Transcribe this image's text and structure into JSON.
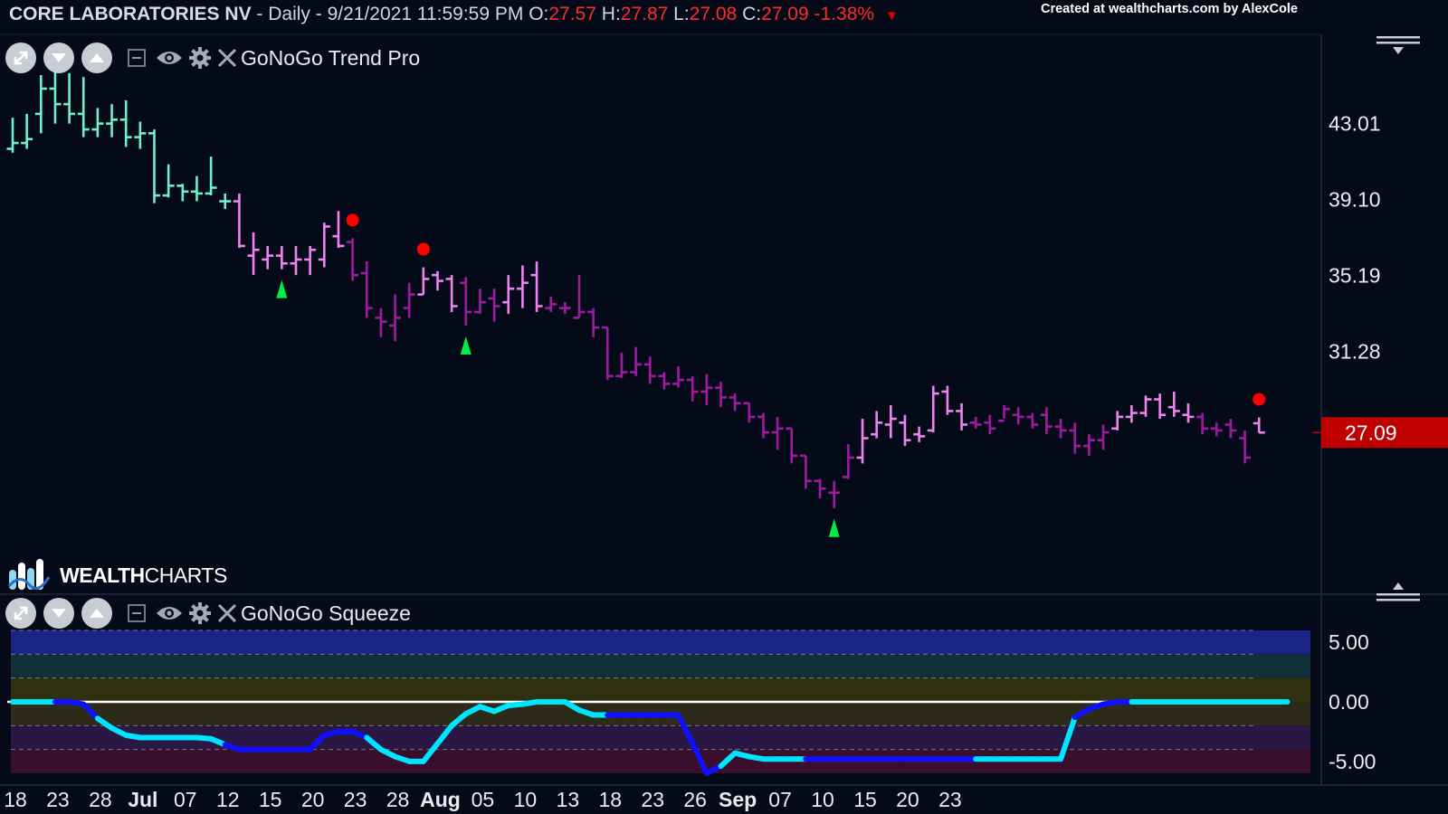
{
  "header": {
    "symbol": "CORE LABORATORIES NV",
    "info": " - Daily - 9/21/2021 11:59:59 PM ",
    "open_label": "O:",
    "open": "27.57",
    "high_label": " H:",
    "high": "27.87",
    "low_label": " L:",
    "low": "27.08",
    "close_label": " C:",
    "close": "27.09",
    "change": " -1.38% ",
    "credit": "Created at wealthcharts.com by AlexCole"
  },
  "icons": [
    "expand-icon",
    "chevron-down-icon",
    "chevron-up-icon",
    "collapse-icon",
    "eye-icon",
    "gear-icon",
    "close-icon",
    "menu-icon"
  ],
  "indicators": {
    "trend": "GoNoGo Trend Pro",
    "squeeze": "GoNoGo Squeeze"
  },
  "logo": {
    "bold": "WEALTH",
    "light": "CHARTS"
  },
  "colors": {
    "background": "#050a18",
    "go_strong": "#6ff0c8",
    "nogo_light": "#ee82ee",
    "nogo_strong": "#a01aa0",
    "reversal_dot": "#ff0000",
    "go_triangle": "#00ee44",
    "price_tag": "#c00000",
    "squeeze_cyan": "#00e5ff",
    "squeeze_blue": "#1010ff",
    "zero_line": "#ffffff"
  },
  "chart_data": [
    {
      "type": "ohlc",
      "name": "GoNoGo Trend Pro",
      "y_ticks": [
        43.01,
        39.1,
        35.19,
        31.28
      ],
      "ylim": [
        19.0,
        47.5
      ],
      "last_price": "27.09",
      "x_ticks": [
        "18",
        "23",
        "28",
        "Jul",
        "07",
        "12",
        "15",
        "20",
        "23",
        "28",
        "Aug",
        "05",
        "10",
        "13",
        "18",
        "23",
        "26",
        "Sep",
        "07",
        "10",
        "15",
        "20",
        "23"
      ],
      "x_tick_indexes": [
        0,
        3,
        6,
        9,
        12,
        15,
        18,
        21,
        24,
        27,
        30,
        33,
        36,
        39,
        42,
        45,
        48,
        51,
        54,
        57,
        60,
        63,
        66
      ],
      "bars": [
        {
          "o": 41.7,
          "h": 43.3,
          "l": 41.5,
          "c": 42.0,
          "s": "go"
        },
        {
          "o": 42.0,
          "h": 43.5,
          "l": 41.7,
          "c": 42.2,
          "s": "go"
        },
        {
          "o": 43.5,
          "h": 45.5,
          "l": 42.5,
          "c": 44.8,
          "s": "go"
        },
        {
          "o": 44.8,
          "h": 45.8,
          "l": 43.0,
          "c": 44.0,
          "s": "go"
        },
        {
          "o": 44.0,
          "h": 45.6,
          "l": 43.0,
          "c": 43.5,
          "s": "go"
        },
        {
          "o": 43.5,
          "h": 45.4,
          "l": 42.3,
          "c": 42.7,
          "s": "go"
        },
        {
          "o": 42.7,
          "h": 43.8,
          "l": 42.3,
          "c": 43.0,
          "s": "go"
        },
        {
          "o": 43.0,
          "h": 44.0,
          "l": 42.3,
          "c": 43.2,
          "s": "go"
        },
        {
          "o": 43.2,
          "h": 44.2,
          "l": 41.8,
          "c": 42.3,
          "s": "go"
        },
        {
          "o": 42.3,
          "h": 43.1,
          "l": 41.7,
          "c": 42.5,
          "s": "go"
        },
        {
          "o": 42.5,
          "h": 42.7,
          "l": 38.9,
          "c": 39.3,
          "s": "go"
        },
        {
          "o": 39.3,
          "h": 40.9,
          "l": 39.2,
          "c": 39.8,
          "s": "go"
        },
        {
          "o": 39.8,
          "h": 39.9,
          "l": 39.0,
          "c": 39.5,
          "s": "go"
        },
        {
          "o": 39.5,
          "h": 40.3,
          "l": 39.0,
          "c": 39.4,
          "s": "go"
        },
        {
          "o": 39.4,
          "h": 41.3,
          "l": 39.3,
          "c": 39.7,
          "s": "go"
        },
        {
          "o": 39.0,
          "h": 39.4,
          "l": 38.6,
          "c": 39.0,
          "s": "go"
        },
        {
          "o": 39.0,
          "h": 39.4,
          "l": 36.6,
          "c": 36.7,
          "s": "nogo"
        },
        {
          "o": 36.2,
          "h": 37.4,
          "l": 35.2,
          "c": 36.5,
          "s": "nogo"
        },
        {
          "o": 36.0,
          "h": 36.7,
          "l": 35.5,
          "c": 36.2,
          "s": "nogo"
        },
        {
          "o": 36.2,
          "h": 36.7,
          "l": 35.5,
          "c": 35.8,
          "s": "nogo"
        },
        {
          "o": 35.8,
          "h": 36.7,
          "l": 35.2,
          "c": 36.0,
          "s": "nogo"
        },
        {
          "o": 36.0,
          "h": 36.7,
          "l": 35.2,
          "c": 36.5,
          "s": "nogo"
        },
        {
          "o": 36.0,
          "h": 37.9,
          "l": 35.6,
          "c": 37.7,
          "s": "nogo"
        },
        {
          "o": 37.2,
          "h": 38.5,
          "l": 36.6,
          "c": 36.7,
          "s": "nogo"
        },
        {
          "o": 36.9,
          "h": 37.1,
          "l": 34.9,
          "c": 35.2,
          "s": "nogo_strong"
        },
        {
          "o": 35.3,
          "h": 35.9,
          "l": 33.0,
          "c": 33.5,
          "s": "nogo_strong"
        },
        {
          "o": 33.0,
          "h": 33.5,
          "l": 32.0,
          "c": 32.8,
          "s": "nogo_strong"
        },
        {
          "o": 32.6,
          "h": 34.2,
          "l": 31.8,
          "c": 33.0,
          "s": "nogo_strong"
        },
        {
          "o": 33.5,
          "h": 34.8,
          "l": 33.0,
          "c": 34.2,
          "s": "nogo_strong"
        },
        {
          "o": 34.2,
          "h": 35.6,
          "l": 34.2,
          "c": 35.0,
          "s": "nogo"
        },
        {
          "o": 35.2,
          "h": 35.4,
          "l": 34.4,
          "c": 34.9,
          "s": "nogo"
        },
        {
          "o": 35.0,
          "h": 35.2,
          "l": 33.3,
          "c": 33.6,
          "s": "nogo"
        },
        {
          "o": 34.8,
          "h": 35.1,
          "l": 32.6,
          "c": 33.3,
          "s": "nogo_strong"
        },
        {
          "o": 33.3,
          "h": 34.5,
          "l": 33.2,
          "c": 33.8,
          "s": "nogo_strong"
        },
        {
          "o": 34.0,
          "h": 34.5,
          "l": 32.8,
          "c": 33.6,
          "s": "nogo_strong"
        },
        {
          "o": 33.8,
          "h": 35.2,
          "l": 33.2,
          "c": 34.5,
          "s": "nogo"
        },
        {
          "o": 34.5,
          "h": 35.7,
          "l": 33.5,
          "c": 34.8,
          "s": "nogo"
        },
        {
          "o": 35.2,
          "h": 35.9,
          "l": 33.3,
          "c": 33.6,
          "s": "nogo"
        },
        {
          "o": 33.5,
          "h": 34.1,
          "l": 33.3,
          "c": 33.7,
          "s": "nogo_strong"
        },
        {
          "o": 33.5,
          "h": 33.8,
          "l": 33.2,
          "c": 33.5,
          "s": "nogo_strong"
        },
        {
          "o": 33.0,
          "h": 35.2,
          "l": 33.0,
          "c": 33.3,
          "s": "nogo_strong"
        },
        {
          "o": 33.3,
          "h": 33.5,
          "l": 32.0,
          "c": 32.5,
          "s": "nogo_strong"
        },
        {
          "o": 32.5,
          "h": 32.5,
          "l": 29.8,
          "c": 30.0,
          "s": "nogo_strong"
        },
        {
          "o": 30.0,
          "h": 31.2,
          "l": 29.9,
          "c": 30.2,
          "s": "nogo_strong"
        },
        {
          "o": 30.2,
          "h": 31.5,
          "l": 30.0,
          "c": 30.6,
          "s": "nogo_strong"
        },
        {
          "o": 30.6,
          "h": 31.0,
          "l": 29.6,
          "c": 30.0,
          "s": "nogo_strong"
        },
        {
          "o": 30.0,
          "h": 30.2,
          "l": 29.3,
          "c": 29.6,
          "s": "nogo_strong"
        },
        {
          "o": 29.6,
          "h": 30.5,
          "l": 29.4,
          "c": 29.8,
          "s": "nogo_strong"
        },
        {
          "o": 29.8,
          "h": 30.0,
          "l": 28.7,
          "c": 29.2,
          "s": "nogo_strong"
        },
        {
          "o": 29.2,
          "h": 30.1,
          "l": 28.5,
          "c": 29.4,
          "s": "nogo_strong"
        },
        {
          "o": 29.4,
          "h": 29.7,
          "l": 28.4,
          "c": 28.9,
          "s": "nogo_strong"
        },
        {
          "o": 28.9,
          "h": 29.1,
          "l": 28.2,
          "c": 28.6,
          "s": "nogo_strong"
        },
        {
          "o": 28.6,
          "h": 28.6,
          "l": 27.6,
          "c": 27.9,
          "s": "nogo_strong"
        },
        {
          "o": 27.9,
          "h": 28.1,
          "l": 26.8,
          "c": 27.1,
          "s": "nogo_strong"
        },
        {
          "o": 27.1,
          "h": 27.9,
          "l": 26.2,
          "c": 27.3,
          "s": "nogo_strong"
        },
        {
          "o": 27.3,
          "h": 27.3,
          "l": 25.5,
          "c": 25.9,
          "s": "nogo_strong"
        },
        {
          "o": 25.9,
          "h": 25.9,
          "l": 24.2,
          "c": 24.6,
          "s": "nogo_strong"
        },
        {
          "o": 24.6,
          "h": 24.7,
          "l": 23.7,
          "c": 24.2,
          "s": "nogo_strong"
        },
        {
          "o": 24.0,
          "h": 24.6,
          "l": 23.2,
          "c": 24.0,
          "s": "nogo_strong"
        },
        {
          "o": 24.8,
          "h": 26.5,
          "l": 24.7,
          "c": 25.8,
          "s": "nogo_strong"
        },
        {
          "o": 25.8,
          "h": 27.8,
          "l": 25.5,
          "c": 26.8,
          "s": "nogo"
        },
        {
          "o": 27.0,
          "h": 28.2,
          "l": 26.8,
          "c": 27.6,
          "s": "nogo"
        },
        {
          "o": 27.5,
          "h": 28.5,
          "l": 26.8,
          "c": 27.8,
          "s": "nogo"
        },
        {
          "o": 27.6,
          "h": 28.0,
          "l": 26.4,
          "c": 26.7,
          "s": "nogo"
        },
        {
          "o": 27.0,
          "h": 27.4,
          "l": 26.6,
          "c": 26.9,
          "s": "nogo"
        },
        {
          "o": 27.2,
          "h": 29.5,
          "l": 27.1,
          "c": 29.1,
          "s": "nogo"
        },
        {
          "o": 29.2,
          "h": 29.5,
          "l": 28.0,
          "c": 28.2,
          "s": "nogo"
        },
        {
          "o": 28.2,
          "h": 28.6,
          "l": 27.2,
          "c": 27.5,
          "s": "nogo"
        },
        {
          "o": 27.6,
          "h": 27.9,
          "l": 27.3,
          "c": 27.5,
          "s": "nogo_strong"
        },
        {
          "o": 27.6,
          "h": 28.0,
          "l": 27.0,
          "c": 27.3,
          "s": "nogo_strong"
        },
        {
          "o": 27.7,
          "h": 28.5,
          "l": 27.8,
          "c": 28.3,
          "s": "nogo_strong"
        },
        {
          "o": 28.0,
          "h": 28.4,
          "l": 27.5,
          "c": 27.9,
          "s": "nogo_strong"
        },
        {
          "o": 27.9,
          "h": 28.1,
          "l": 27.3,
          "c": 27.5,
          "s": "nogo_strong"
        },
        {
          "o": 28.0,
          "h": 28.4,
          "l": 27.0,
          "c": 27.4,
          "s": "nogo_strong"
        },
        {
          "o": 27.4,
          "h": 27.8,
          "l": 26.8,
          "c": 27.2,
          "s": "nogo_strong"
        },
        {
          "o": 27.2,
          "h": 27.6,
          "l": 26.0,
          "c": 26.4,
          "s": "nogo_strong"
        },
        {
          "o": 26.4,
          "h": 27.0,
          "l": 25.9,
          "c": 26.7,
          "s": "nogo_strong"
        },
        {
          "o": 26.7,
          "h": 27.5,
          "l": 26.2,
          "c": 27.1,
          "s": "nogo_strong"
        },
        {
          "o": 27.3,
          "h": 28.2,
          "l": 27.2,
          "c": 27.9,
          "s": "nogo"
        },
        {
          "o": 27.9,
          "h": 28.5,
          "l": 27.6,
          "c": 28.1,
          "s": "nogo"
        },
        {
          "o": 28.1,
          "h": 29.0,
          "l": 27.9,
          "c": 28.8,
          "s": "nogo"
        },
        {
          "o": 28.8,
          "h": 29.1,
          "l": 27.8,
          "c": 28.0,
          "s": "nogo"
        },
        {
          "o": 28.4,
          "h": 29.2,
          "l": 27.9,
          "c": 28.2,
          "s": "nogo"
        },
        {
          "o": 28.0,
          "h": 28.6,
          "l": 27.6,
          "c": 27.9,
          "s": "nogo"
        },
        {
          "o": 27.9,
          "h": 28.1,
          "l": 27.0,
          "c": 27.3,
          "s": "nogo_strong"
        },
        {
          "o": 27.3,
          "h": 27.6,
          "l": 26.9,
          "c": 27.2,
          "s": "nogo_strong"
        },
        {
          "o": 27.5,
          "h": 27.8,
          "l": 26.8,
          "c": 27.2,
          "s": "nogo_strong"
        },
        {
          "o": 26.8,
          "h": 27.2,
          "l": 25.5,
          "c": 25.8,
          "s": "nogo_strong"
        },
        {
          "o": 27.57,
          "h": 27.87,
          "l": 27.08,
          "c": 27.09,
          "s": "nogo"
        }
      ],
      "reversal_dots": [
        24,
        29,
        88
      ],
      "go_triangles": [
        19,
        32,
        58
      ]
    },
    {
      "type": "line",
      "name": "GoNoGo Squeeze",
      "y_ticks": [
        5.0,
        0.0,
        -5.0
      ],
      "ylim": [
        -6.0,
        6.0
      ],
      "values": [
        0,
        0,
        0,
        0,
        0,
        -0.2,
        -1.4,
        -2.2,
        -2.8,
        -3.0,
        -3.0,
        -3.0,
        -3.0,
        -3.0,
        -3.1,
        -3.6,
        -4.0,
        -4.0,
        -4.0,
        -4.0,
        -4.0,
        -4.0,
        -2.8,
        -2.5,
        -2.5,
        -3.0,
        -4.0,
        -4.6,
        -5.0,
        -5.0,
        -3.5,
        -2.0,
        -1.0,
        -0.4,
        -0.8,
        -0.3,
        -0.2,
        0,
        0,
        0,
        -0.7,
        -1.1,
        -1.1,
        -1.1,
        -1.1,
        -1.1,
        -1.1,
        -1.1,
        -3.5,
        -6.0,
        -5.4,
        -4.3,
        -4.6,
        -4.8,
        -4.8,
        -4.8,
        -4.8,
        -4.8,
        -4.8,
        -4.8,
        -4.8,
        -4.8,
        -4.8,
        -4.8,
        -4.8,
        -4.8,
        -4.8,
        -4.8,
        -4.8,
        -4.8,
        -4.8,
        -4.8,
        -4.8,
        -4.8,
        -4.8,
        -1.3,
        -0.6,
        -0.2,
        0,
        0,
        0,
        0,
        0,
        0,
        0,
        0,
        0,
        0,
        0,
        0,
        0
      ],
      "strength": [
        1,
        1,
        1,
        0,
        0,
        0,
        1,
        1,
        1,
        1,
        1,
        1,
        1,
        1,
        1,
        0,
        0,
        0,
        0,
        0,
        0,
        0,
        0,
        0,
        0,
        1,
        1,
        1,
        1,
        1,
        1,
        1,
        1,
        1,
        1,
        1,
        1,
        1,
        1,
        1,
        1,
        1,
        0,
        0,
        0,
        0,
        0,
        0,
        0,
        0,
        1,
        1,
        1,
        1,
        1,
        1,
        0,
        0,
        0,
        0,
        0,
        0,
        0,
        0,
        0,
        0,
        0,
        0,
        1,
        1,
        1,
        1,
        1,
        1,
        1,
        0,
        0,
        0,
        0,
        1,
        1,
        1,
        1,
        1,
        1,
        1,
        1,
        1,
        1,
        1,
        1
      ]
    }
  ]
}
